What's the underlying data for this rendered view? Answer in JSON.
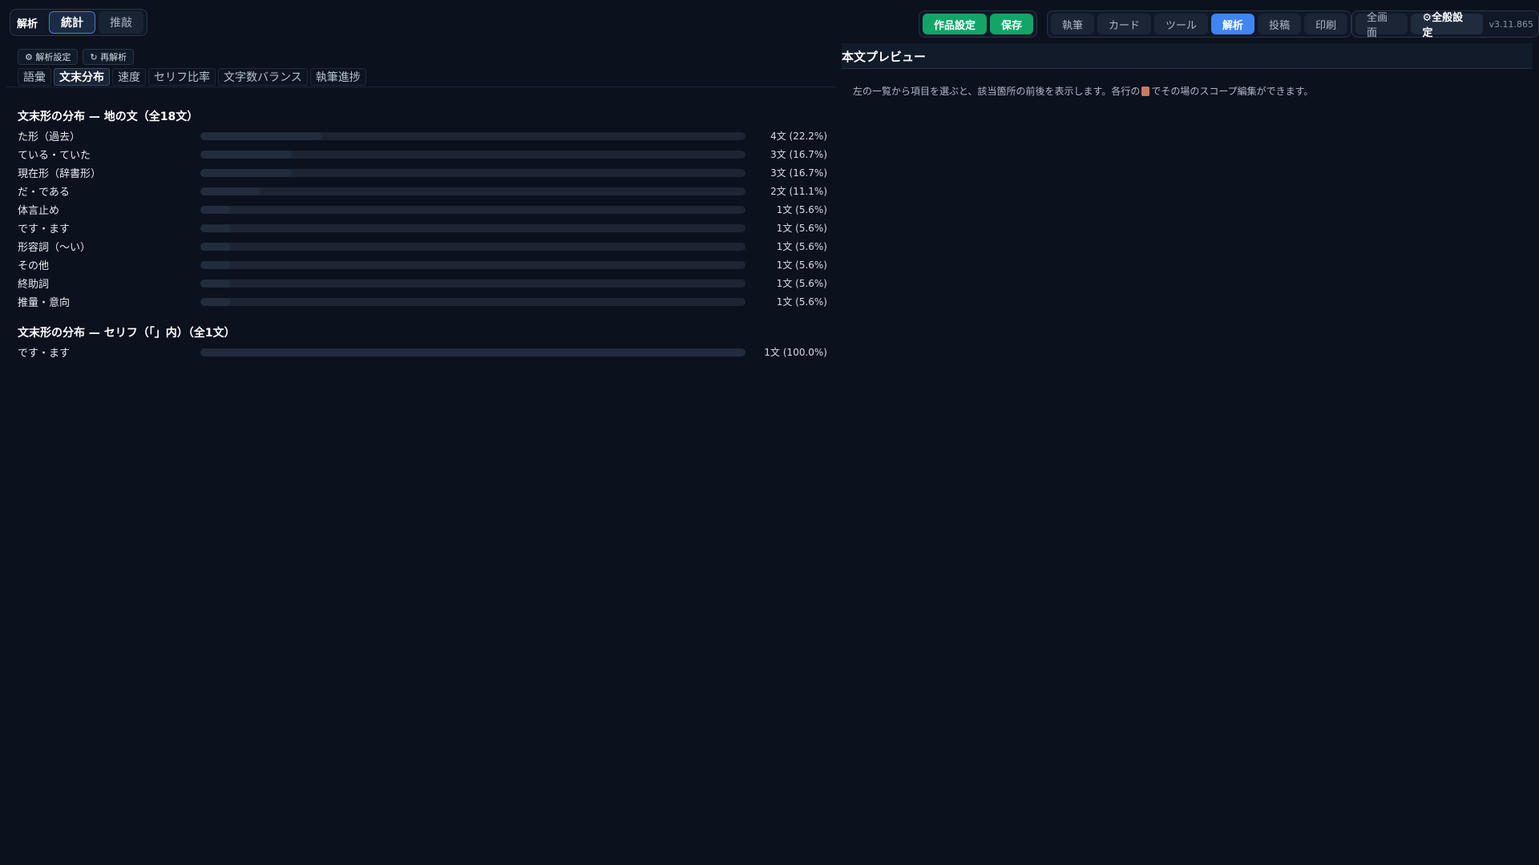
{
  "header": {
    "mode_label": "解析",
    "mode_tabs": [
      {
        "label": "統計",
        "active": true
      },
      {
        "label": "推敲",
        "active": false
      }
    ],
    "work_settings": "作品設定",
    "save": "保存",
    "nav_tabs": [
      {
        "label": "執筆",
        "active": false
      },
      {
        "label": "カード",
        "active": false
      },
      {
        "label": "ツール",
        "active": false
      },
      {
        "label": "解析",
        "active": true
      },
      {
        "label": "投稿",
        "active": false
      },
      {
        "label": "印刷",
        "active": false
      }
    ],
    "fullscreen": "全画面",
    "general_settings": "⚙全般設定",
    "version": "v3.11.865"
  },
  "left": {
    "analysis_settings": "⚙ 解析設定",
    "reanalyze": "↻ 再解析",
    "tabs": [
      {
        "label": "語彙",
        "active": false
      },
      {
        "label": "文末分布",
        "active": true
      },
      {
        "label": "速度",
        "active": false
      },
      {
        "label": "セリフ比率",
        "active": false
      },
      {
        "label": "文字数バランス",
        "active": false
      },
      {
        "label": "執筆進捗",
        "active": false
      }
    ],
    "section1": {
      "title": "文末形の分布 — 地の文（全18文）",
      "rows": [
        {
          "label": "た形（過去）",
          "value": "4文 (22.2%)",
          "fraction": 0.222
        },
        {
          "label": "ている・ていた",
          "value": "3文 (16.7%)",
          "fraction": 0.167
        },
        {
          "label": "現在形（辞書形）",
          "value": "3文 (16.7%)",
          "fraction": 0.167
        },
        {
          "label": "だ・である",
          "value": "2文 (11.1%)",
          "fraction": 0.111
        },
        {
          "label": "体言止め",
          "value": "1文 (5.6%)",
          "fraction": 0.056
        },
        {
          "label": "です・ます",
          "value": "1文 (5.6%)",
          "fraction": 0.056
        },
        {
          "label": "形容詞（〜い）",
          "value": "1文 (5.6%)",
          "fraction": 0.056
        },
        {
          "label": "その他",
          "value": "1文 (5.6%)",
          "fraction": 0.056
        },
        {
          "label": "終助詞",
          "value": "1文 (5.6%)",
          "fraction": 0.056
        },
        {
          "label": "推量・意向",
          "value": "1文 (5.6%)",
          "fraction": 0.056
        }
      ]
    },
    "section2": {
      "title": "文末形の分布 — セリフ（「」内）（全1文）",
      "rows": [
        {
          "label": "です・ます",
          "value": "1文 (100.0%)",
          "fraction": 1.0
        }
      ]
    }
  },
  "right": {
    "title": "本文プレビュー",
    "hint_before": "左の一覧から項目を選ぶと、該当箇所の前後を表示します。各行の",
    "hint_icon": "document-icon",
    "hint_after": "でその場のスコープ編集ができます。"
  }
}
